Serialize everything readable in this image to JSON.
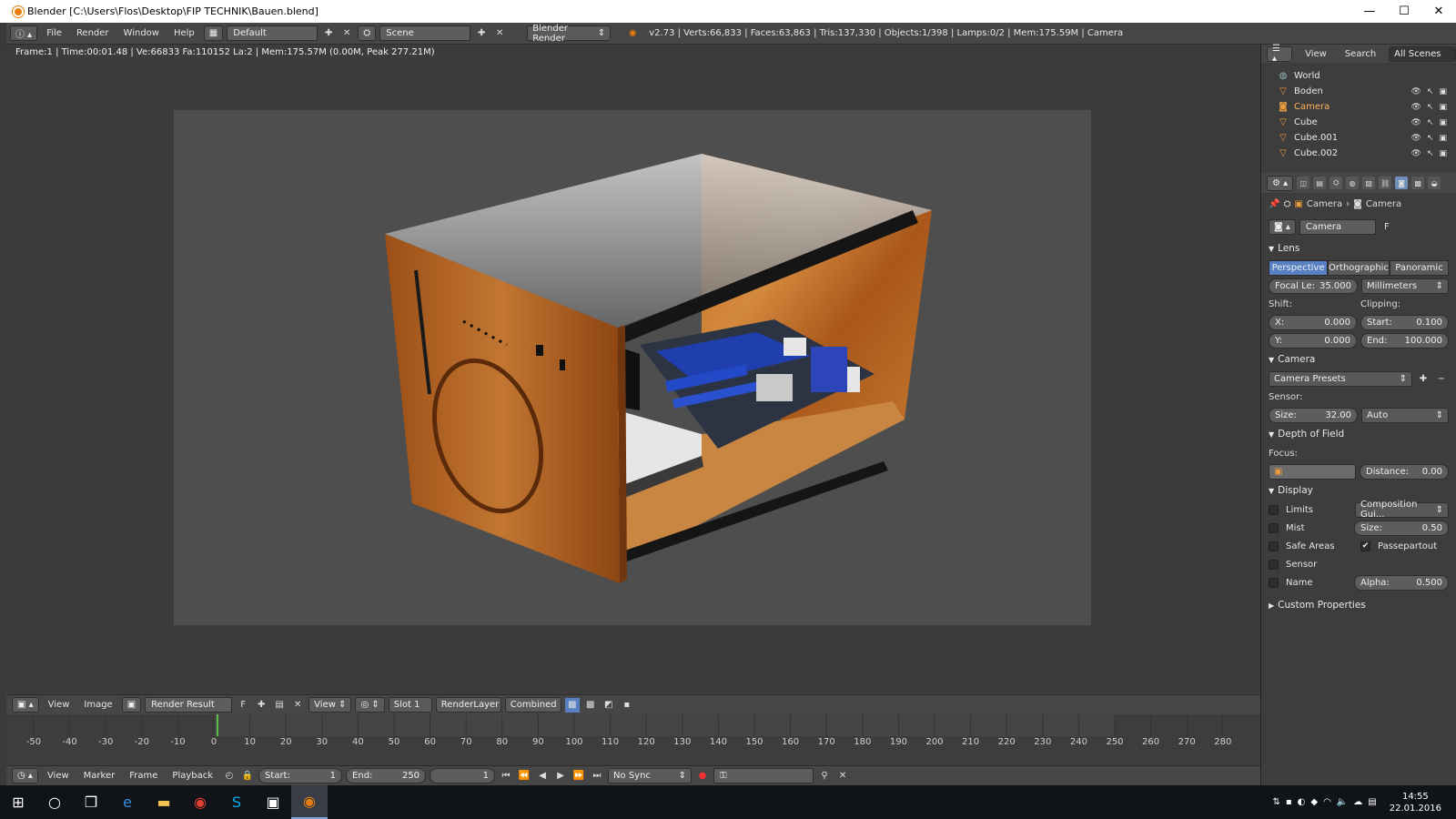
{
  "window": {
    "title": "Blender [C:\\Users\\Flos\\Desktop\\FIP TECHNIK\\Bauen.blend]",
    "minimize": "—",
    "maximize": "☐",
    "close": "✕"
  },
  "infobar": {
    "menus": [
      "File",
      "Render",
      "Window",
      "Help"
    ],
    "screen_layout": "Default",
    "scene": "Scene",
    "engine": "Blender Render",
    "stats": "v2.73 | Verts:66,833 | Faces:63,863 | Tris:137,330 | Objects:1/398 | Lamps:0/2 | Mem:175.59M | Camera"
  },
  "viewport": {
    "info": "Frame:1 | Time:00:01.48 | Ve:66833 Fa:110152 La:2 | Mem:175.57M (0.00M, Peak 277.21M)"
  },
  "image_editor": {
    "menus": [
      "View",
      "Image"
    ],
    "image": "Render Result",
    "fake_user": "F",
    "view": "View",
    "slot": "Slot 1",
    "layer": "RenderLayer",
    "pass": "Combined"
  },
  "timeline": {
    "ticks": [
      "-50",
      "-40",
      "-30",
      "-20",
      "-10",
      "0",
      "10",
      "20",
      "30",
      "40",
      "50",
      "60",
      "70",
      "80",
      "90",
      "100",
      "110",
      "120",
      "130",
      "140",
      "150",
      "160",
      "170",
      "180",
      "190",
      "200",
      "210",
      "220",
      "230",
      "240",
      "250",
      "260",
      "270",
      "280"
    ],
    "current_frame": 1,
    "menus": [
      "View",
      "Marker",
      "Frame",
      "Playback"
    ],
    "start_label": "Start:",
    "start": "1",
    "end_label": "End:",
    "end": "250",
    "frame": "1",
    "sync": "No Sync"
  },
  "outliner": {
    "menus": [
      "View",
      "Search"
    ],
    "filter": "All Scenes",
    "items": [
      {
        "name": "World",
        "icon": "world-icon"
      },
      {
        "name": "Boden",
        "icon": "mesh-icon"
      },
      {
        "name": "Camera",
        "icon": "camera-icon"
      },
      {
        "name": "Cube",
        "icon": "mesh-icon"
      },
      {
        "name": "Cube.001",
        "icon": "mesh-icon"
      },
      {
        "name": "Cube.002",
        "icon": "mesh-icon"
      }
    ]
  },
  "properties": {
    "breadcrumb": [
      "Camera",
      "Camera"
    ],
    "datablock": "Camera",
    "datablock_f": "F",
    "lens": {
      "title": "Lens",
      "types": [
        "Perspective",
        "Orthographic",
        "Panoramic"
      ],
      "focal_label": "Focal Le:",
      "focal": "35.000",
      "unit": "Millimeters",
      "shift_label": "Shift:",
      "clipping_label": "Clipping:",
      "x_label": "X:",
      "x": "0.000",
      "y_label": "Y:",
      "y": "0.000",
      "start_label": "Start:",
      "start": "0.100",
      "end_label": "End:",
      "end": "100.000"
    },
    "camera": {
      "title": "Camera",
      "presets": "Camera Presets",
      "sensor_label": "Sensor:",
      "size_label": "Size:",
      "size": "32.00",
      "fit": "Auto"
    },
    "dof": {
      "title": "Depth of Field",
      "focus_label": "Focus:",
      "distance_label": "Distance:",
      "distance": "0.00"
    },
    "display": {
      "title": "Display",
      "checks": [
        "Limits",
        "Mist",
        "Safe Areas",
        "Sensor",
        "Name"
      ],
      "composition": "Composition Gui...",
      "size_label": "Size:",
      "size": "0.50",
      "passepartout": "Passepartout",
      "alpha_label": "Alpha:",
      "alpha": "0.500"
    },
    "custom": "Custom Properties"
  },
  "taskbar": {
    "time": "14:55",
    "date": "22.01.2016"
  }
}
